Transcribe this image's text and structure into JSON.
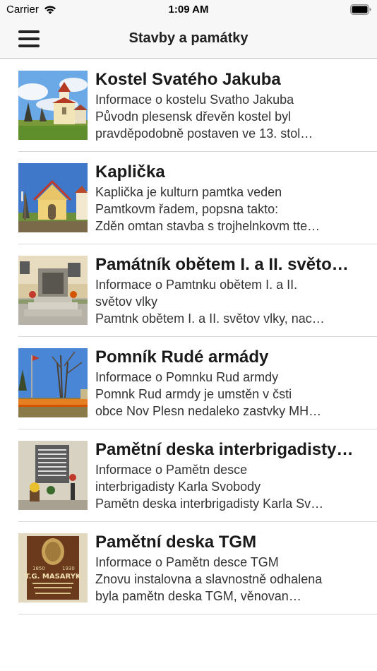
{
  "status_bar": {
    "carrier": "Carrier",
    "time": "1:09 AM"
  },
  "nav": {
    "title": "Stavby a památky",
    "menu_icon": "hamburger-menu-icon"
  },
  "items": [
    {
      "title": "Kostel Svatého Jakuba",
      "lines": [
        "Informace o kostelu Svatho Jakuba",
        "Původn plesensk dřevěn kostel byl",
        "pravděpodobně postaven ve 13. stol…"
      ]
    },
    {
      "title": "Kaplička",
      "lines": [
        "Kaplička je kulturn pamtka veden",
        "Pamtkovm řadem, popsna takto:",
        "Zděn omtan stavba s trojhelnkovm tte…"
      ]
    },
    {
      "title": "Památník obětem I. a II. světo…",
      "lines": [
        "Informace o Pamtnku obětem I. a II.",
        "světov vlky",
        "Pamtnk obětem I. a II. světov vlky, nac…"
      ]
    },
    {
      "title": "Pomník Rudé armády",
      "lines": [
        "Informace o Pomnku Rud armdy",
        "Pomnk Rud armdy je umstěn v čsti",
        "obce Nov Plesn nedaleko zastvky MH…"
      ]
    },
    {
      "title": "Pamětní deska interbrigadisty…",
      "lines": [
        "Informace o Pamětn desce",
        "interbrigadisty Karla Svobody",
        "Pamětn deska interbrigadisty Karla Sv…"
      ]
    },
    {
      "title": "Pamětní deska TGM",
      "lines": [
        "Informace o Pamětn desce TGM",
        "Znovu instalovna a slavnostně odhalena",
        "byla pamětn deska TGM, věnovan…"
      ],
      "plaque_text": [
        "1850",
        "1930",
        "T.G. MASARYK"
      ]
    }
  ]
}
